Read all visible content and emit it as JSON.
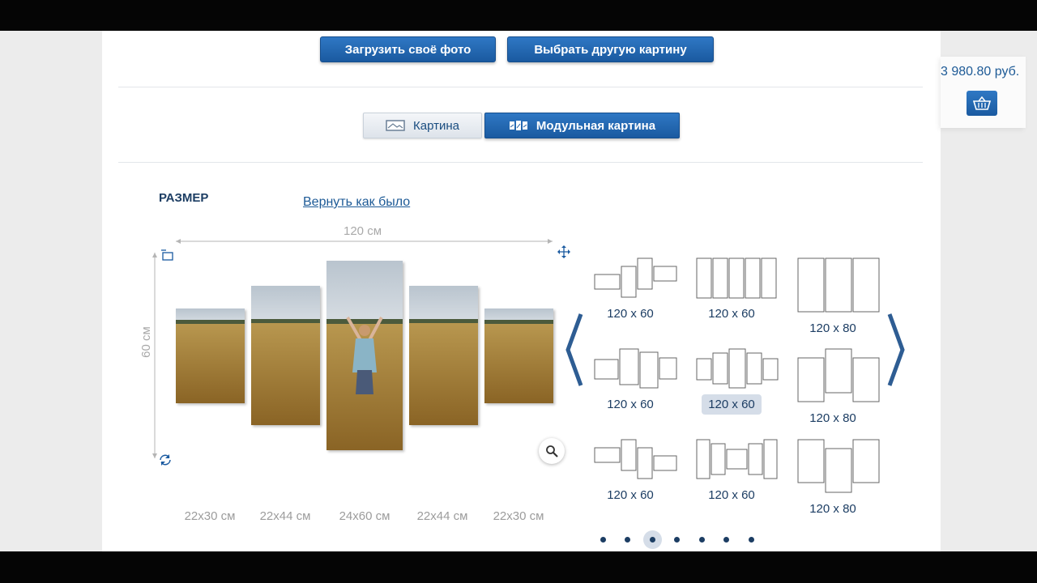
{
  "buttons": {
    "upload": "Загрузить своё фото",
    "choose": "Выбрать другую картину"
  },
  "tabs": [
    {
      "label": "Картина",
      "icon": "single-picture-icon",
      "active": false
    },
    {
      "label": "Модульная картина",
      "icon": "modular-picture-icon",
      "active": true
    }
  ],
  "size_section": {
    "title": "РАЗМЕР",
    "revert_link": "Вернуть как было",
    "width_label": "120 см",
    "height_label": "60 см"
  },
  "panel_sizes": [
    "22x30 см",
    "22x44 см",
    "24x60 см",
    "22x44 см",
    "22x30 см"
  ],
  "layout_options": [
    {
      "label": "120 x 60",
      "selected": false
    },
    {
      "label": "120 x 60",
      "selected": false
    },
    {
      "label": "120 x 80",
      "selected": false
    },
    {
      "label": "120 x 60",
      "selected": false
    },
    {
      "label": "120 x 60",
      "selected": true
    },
    {
      "label": "120 x 80",
      "selected": false
    },
    {
      "label": "120 x 60",
      "selected": false
    },
    {
      "label": "120 x 60",
      "selected": false
    },
    {
      "label": "120 x 80",
      "selected": false
    }
  ],
  "pagination": {
    "total": 7,
    "active": 3
  },
  "cart": {
    "price": "3 980.80 руб."
  },
  "colors": {
    "brand_blue": "#1a5aa0",
    "dark_text": "#1c3d63",
    "muted": "#a9a9a9"
  }
}
